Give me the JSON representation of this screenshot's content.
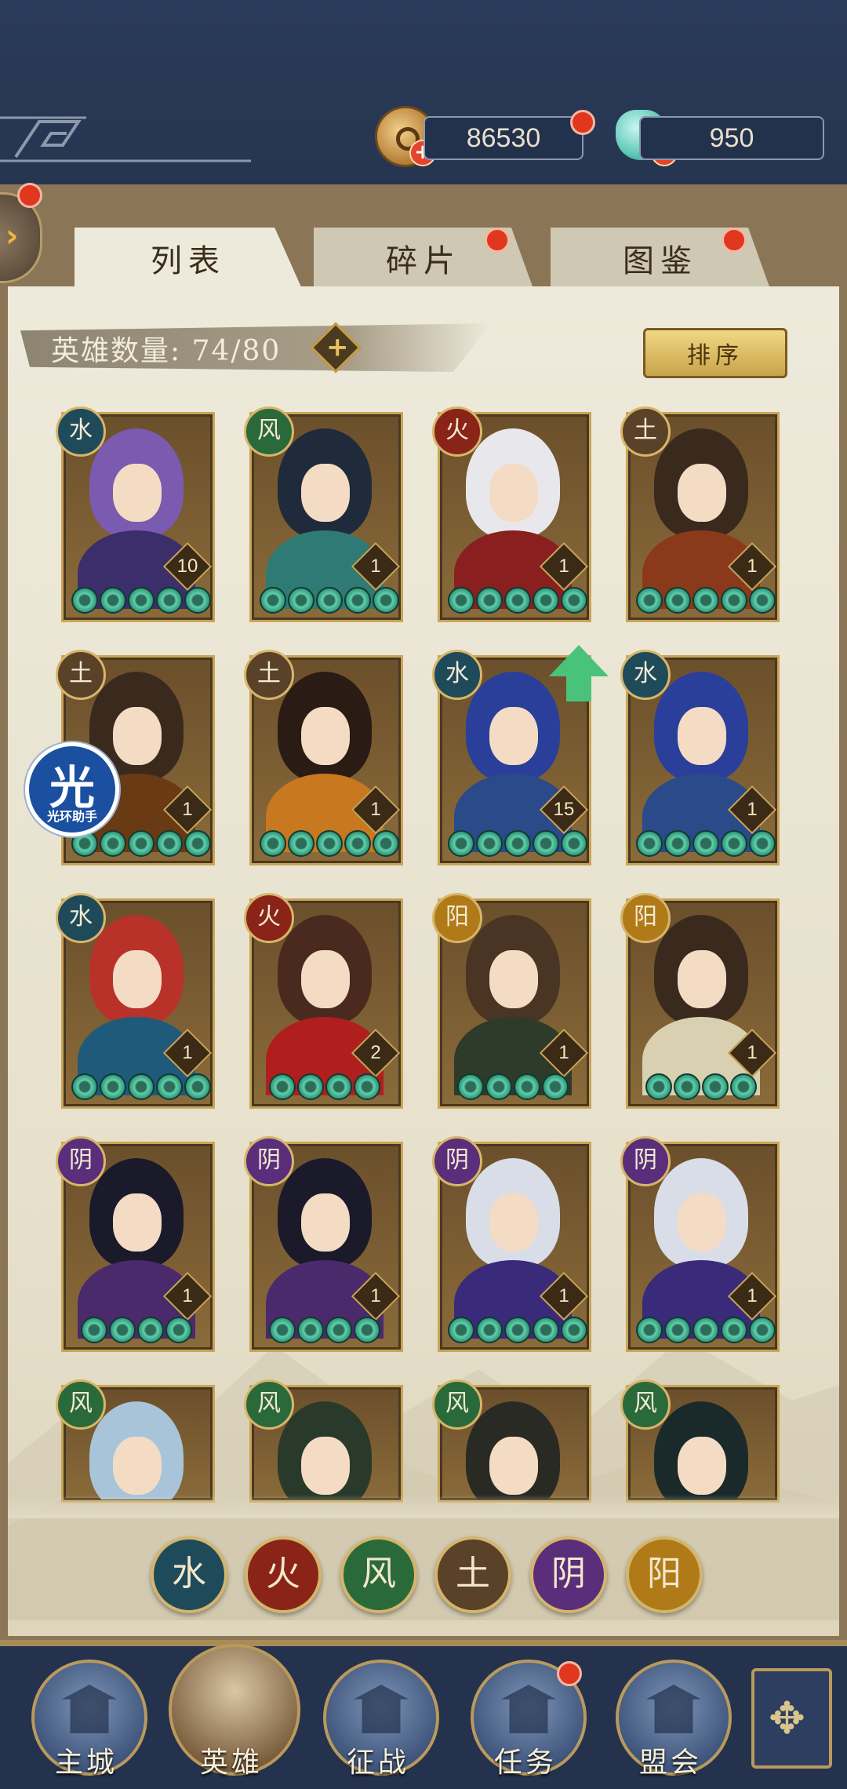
{
  "currency": {
    "coins": "86530",
    "gems": "950"
  },
  "tabs": [
    {
      "label": "列表"
    },
    {
      "label": "碎片"
    },
    {
      "label": "图鉴"
    }
  ],
  "hero_count": "英雄数量: 74/80",
  "sort_label": "排序",
  "heroes": [
    {
      "element": "水",
      "level": "10",
      "stars": 5,
      "hair": "#7a5bb0",
      "body": "#3b2e6a"
    },
    {
      "element": "风",
      "level": "1",
      "stars": 5,
      "hair": "#1f2b3a",
      "body": "#2f7a74"
    },
    {
      "element": "火",
      "level": "1",
      "stars": 5,
      "hair": "#e8e8ec",
      "body": "#8a1f1f"
    },
    {
      "element": "土",
      "level": "1",
      "stars": 5,
      "hair": "#3a2a1e",
      "body": "#8a3a1a"
    },
    {
      "element": "土",
      "level": "1",
      "stars": 5,
      "hair": "#3a2a1e",
      "body": "#6a3a14"
    },
    {
      "element": "土",
      "level": "1",
      "stars": 5,
      "hair": "#2a1c14",
      "body": "#c8781e"
    },
    {
      "element": "水",
      "level": "15",
      "stars": 5,
      "hair": "#2a3f9a",
      "body": "#2b4a8a"
    },
    {
      "element": "水",
      "level": "1",
      "stars": 5,
      "hair": "#2a3f9a",
      "body": "#2b4a8a"
    },
    {
      "element": "水",
      "level": "1",
      "stars": 5,
      "hair": "#b8322a",
      "body": "#1f5a7a"
    },
    {
      "element": "火",
      "level": "2",
      "stars": 4,
      "hair": "#4a2a1e",
      "body": "#b01e1e"
    },
    {
      "element": "阳",
      "level": "1",
      "stars": 4,
      "hair": "#4a3424",
      "body": "#2e3a2a"
    },
    {
      "element": "阳",
      "level": "1",
      "stars": 4,
      "hair": "#3a2a1e",
      "body": "#d8d0b0"
    },
    {
      "element": "阴",
      "level": "1",
      "stars": 4,
      "hair": "#1a1a2a",
      "body": "#4a2a6a"
    },
    {
      "element": "阴",
      "level": "1",
      "stars": 4,
      "hair": "#1a1a2a",
      "body": "#4a2a6a"
    },
    {
      "element": "阴",
      "level": "1",
      "stars": 5,
      "hair": "#d8dde8",
      "body": "#3a2a7a"
    },
    {
      "element": "阴",
      "level": "1",
      "stars": 5,
      "hair": "#d8dde8",
      "body": "#3a2a7a"
    },
    {
      "element": "风",
      "level": "",
      "stars": 0,
      "hair": "#a8c4d8",
      "body": "#3a7a3a"
    },
    {
      "element": "风",
      "level": "",
      "stars": 0,
      "hair": "#2a3a2a",
      "body": "#3a5a3a"
    },
    {
      "element": "风",
      "level": "",
      "stars": 0,
      "hair": "#2a2a24",
      "body": "#e0dcd0"
    },
    {
      "element": "风",
      "level": "",
      "stars": 0,
      "hair": "#1a2a2a",
      "body": "#2a6a5a"
    }
  ],
  "element_filters": [
    {
      "glyph": "水",
      "color": "#1f4a5a"
    },
    {
      "glyph": "火",
      "color": "#8a2418"
    },
    {
      "glyph": "风",
      "color": "#2a6a3a"
    },
    {
      "glyph": "土",
      "color": "#5a4228"
    },
    {
      "glyph": "阴",
      "color": "#5a2e7a"
    },
    {
      "glyph": "阳",
      "color": "#b07a18"
    }
  ],
  "element_colors": {
    "水": "#1f4a5a",
    "火": "#8a2418",
    "风": "#2a6a3a",
    "土": "#5a4228",
    "阴": "#5a2e7a",
    "阳": "#b07a18"
  },
  "watermark": {
    "big": "光",
    "small": "光环助手"
  },
  "nav": [
    {
      "label": "主城"
    },
    {
      "label": "英雄"
    },
    {
      "label": "征战"
    },
    {
      "label": "任务"
    },
    {
      "label": "盟会"
    }
  ],
  "more_icon": "✥"
}
